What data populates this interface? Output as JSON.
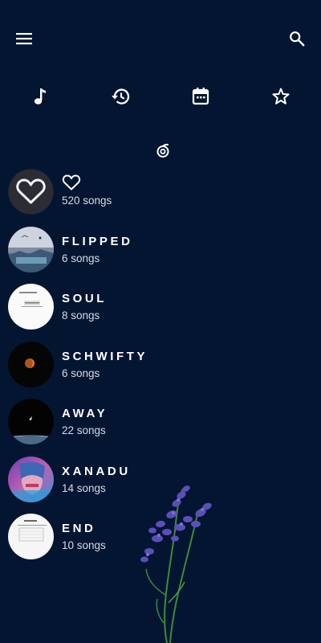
{
  "toolbar": {
    "menu_icon": "menu-icon",
    "search_icon": "search-icon"
  },
  "tabs": [
    {
      "name": "songs",
      "icon": "music-note-icon"
    },
    {
      "name": "history",
      "icon": "history-icon"
    },
    {
      "name": "calendar",
      "icon": "calendar-icon"
    },
    {
      "name": "favorites",
      "icon": "star-icon"
    }
  ],
  "sort_icon": "sort-icon",
  "playlists": [
    {
      "title": "",
      "title_icon": "heart-icon",
      "subtitle": "520 songs",
      "cover": "neon-heart"
    },
    {
      "title": "FLIPPED",
      "subtitle": "6 songs",
      "cover": "landscape"
    },
    {
      "title": "SOUL",
      "subtitle": "8 songs",
      "cover": "white-card"
    },
    {
      "title": "SCHWIFTY",
      "subtitle": "6 songs",
      "cover": "moon"
    },
    {
      "title": "AWAY",
      "subtitle": "22 songs",
      "cover": "night"
    },
    {
      "title": "XANADU",
      "subtitle": "14 songs",
      "cover": "portrait"
    },
    {
      "title": "END",
      "subtitle": "10 songs",
      "cover": "paper"
    }
  ],
  "colors": {
    "background": "#041532",
    "text": "#ffffff",
    "subtext": "#d6dbe4"
  }
}
